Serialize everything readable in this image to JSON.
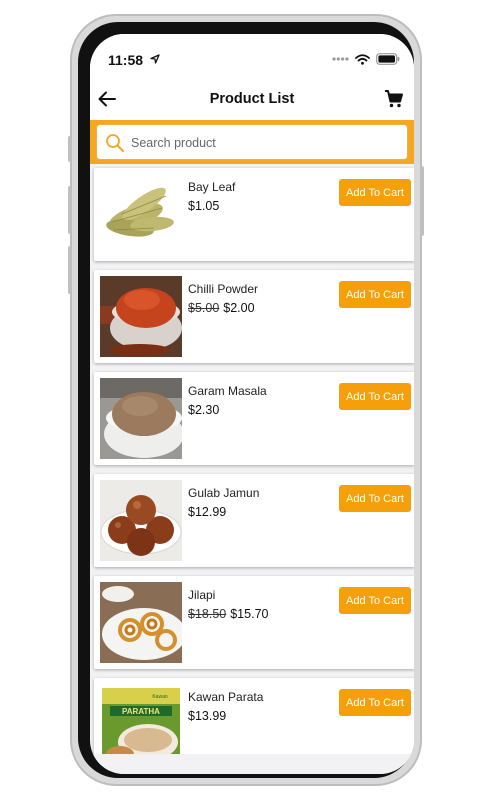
{
  "status": {
    "time": "11:58"
  },
  "header": {
    "title": "Product List"
  },
  "search": {
    "placeholder": "Search product"
  },
  "products": [
    {
      "name": "Bay Leaf",
      "old_price": "",
      "price": "$1.05",
      "button": "Add To Cart"
    },
    {
      "name": "Chilli Powder",
      "old_price": "$5.00",
      "price": "$2.00",
      "button": "Add To Cart"
    },
    {
      "name": "Garam Masala",
      "old_price": "",
      "price": "$2.30",
      "button": "Add To Cart"
    },
    {
      "name": "Gulab Jamun",
      "old_price": "",
      "price": "$12.99",
      "button": "Add To Cart"
    },
    {
      "name": "Jilapi",
      "old_price": "$18.50",
      "price": "$15.70",
      "button": "Add To Cart"
    },
    {
      "name": "Kawan Parata",
      "old_price": "",
      "price": "$13.99",
      "button": "Add To Cart"
    }
  ],
  "packaging": {
    "brand": "Kawan",
    "label": "PARATHA"
  },
  "colors": {
    "accent": "#f5a623",
    "button": "#f5a00a"
  }
}
